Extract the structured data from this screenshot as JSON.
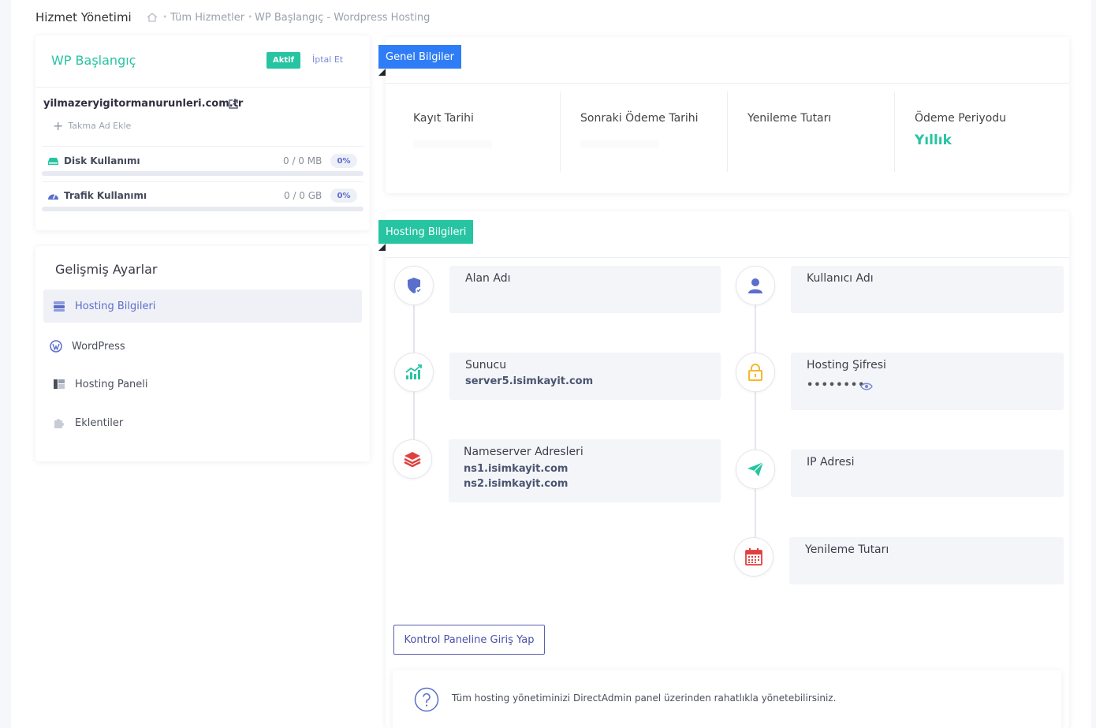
{
  "header": {
    "title": "Hizmet Yönetimi",
    "breadcrumb": [
      "Tüm Hizmetler",
      "WP Başlangıç - Wordpress Hosting"
    ]
  },
  "service_card": {
    "package_name": "WP Başlangıç",
    "status_badge": "Aktif",
    "cancel_label": "İptal Et",
    "domain": "yilmazeryigitormanurunleri.com.tr",
    "alias_label": "Takma Ad Ekle",
    "disk": {
      "label": "Disk Kullanımı",
      "value": "0 / 0 MB",
      "percent": "0%"
    },
    "traffic": {
      "label": "Trafik Kullanımı",
      "value": "0 / 0 GB",
      "percent": "0%"
    }
  },
  "advanced": {
    "title": "Gelişmiş Ayarlar",
    "items": [
      {
        "label": "Hosting Bilgileri",
        "icon": "server-icon",
        "active": true
      },
      {
        "label": "WordPress",
        "icon": "wordpress-icon",
        "active": false
      },
      {
        "label": "Hosting Paneli",
        "icon": "panel-icon",
        "active": false
      },
      {
        "label": "Eklentiler",
        "icon": "puzzle-icon",
        "active": false
      }
    ]
  },
  "general_info": {
    "ribbon": "Genel Bilgiler",
    "fields": [
      {
        "label": "Kayıt Tarihi",
        "value": ""
      },
      {
        "label": "Sonraki Ödeme Tarihi",
        "value": ""
      },
      {
        "label": "Yenileme Tutarı",
        "value": ""
      },
      {
        "label": "Ödeme Periyodu",
        "value": "Yıllık"
      }
    ]
  },
  "hosting_info": {
    "ribbon": "Hosting Bilgileri",
    "domain_label": "Alan Adı",
    "server_label": "Sunucu",
    "server_value": "server5.isimkayit.com",
    "nameserver_label": "Nameserver Adresleri",
    "ns1": "ns1.isimkayit.com",
    "ns2": "ns2.isimkayit.com",
    "username_label": "Kullanıcı Adı",
    "password_label": "Hosting Şifresi",
    "password_mask": "••••••••",
    "ip_label": "IP Adresi",
    "renewal_label": "Yenileme Tutarı"
  },
  "actions": {
    "panel_button": "Kontrol Paneline Giriş Yap"
  },
  "notice": {
    "text": "Tüm hosting yönetiminizi DirectAdmin panel üzerinden rahatlıkla yönetebilirsiniz."
  },
  "colors": {
    "accent_green": "#27c4a2",
    "accent_blue": "#2f7df6",
    "accent_purple": "#5a6ecb"
  }
}
